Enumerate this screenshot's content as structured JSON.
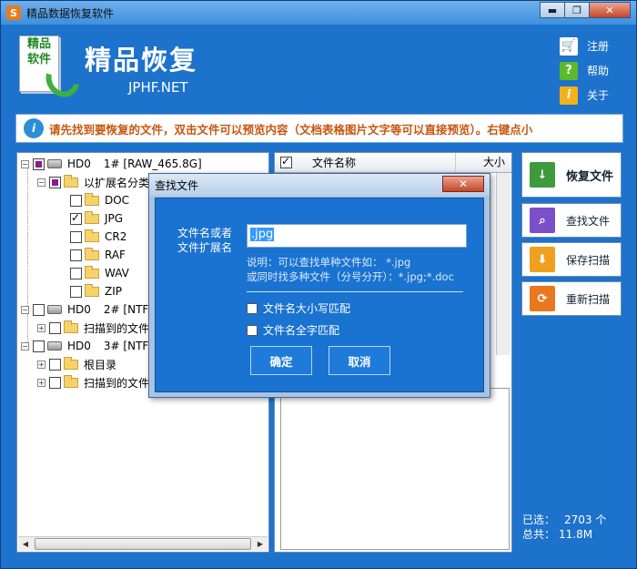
{
  "window": {
    "title": "精品数据恢复软件",
    "app_icon": "S",
    "min_glyph": "▬",
    "max_glyph": "❐",
    "close_glyph": "✕"
  },
  "header": {
    "logo_text": [
      "精品",
      "软件"
    ],
    "brand": "精品恢复",
    "subtitle": "JPHF.NET",
    "links": [
      {
        "label": "注册",
        "icon": "cart-icon",
        "glyph": "🛒"
      },
      {
        "label": "帮助",
        "icon": "help-icon",
        "glyph": "?"
      },
      {
        "label": "关于",
        "icon": "info-icon",
        "glyph": "i"
      }
    ]
  },
  "notice": {
    "glyph": "i",
    "text": "请先找到要恢复的文件，双击文件可以预览内容（文档表格图片文字等可以直接预览）。右键点小"
  },
  "tree": {
    "hd0_1": {
      "name": "HD0",
      "label": "1# [RAW_465.8G]"
    },
    "ext_group": "以扩展名分类",
    "ext": [
      "DOC",
      "JPG",
      "CR2",
      "RAF",
      "WAV",
      "ZIP"
    ],
    "hd0_2": {
      "name": "HD0",
      "label": "2# [NTFS"
    },
    "scanned_1": "扫描到的文件",
    "hd0_3": {
      "name": "HD0",
      "label": "3# [NTFS"
    },
    "root": "根目录",
    "scanned_2": "扫描到的文件"
  },
  "list": {
    "col_name": "文件名称",
    "col_size": "大小"
  },
  "buttons": {
    "recover": "恢复文件",
    "find": "查找文件",
    "save": "保存扫描",
    "rescan": "重新扫描"
  },
  "stats": {
    "selected_label": "已选：",
    "selected_value": "2703 个",
    "total_label": "总共：",
    "total_value": "11.8M"
  },
  "dialog": {
    "title": "查找文件",
    "close_glyph": "✕",
    "label_line1": "文件名或者",
    "label_line2": "文件扩展名",
    "input_value": ".jpg",
    "hint_line1": "说明：可以查找单种文件如： *.jpg",
    "hint_line2": "或同时找多种文件（分号分开）：*.jpg;*.doc",
    "opt_case": "文件名大小写匹配",
    "opt_whole": "文件名全字匹配",
    "ok": "确定",
    "cancel": "取消"
  },
  "colors": {
    "window_bg": "#1d72cc",
    "notice_text": "#c8560e",
    "dialog_body": "#1a73d0"
  }
}
